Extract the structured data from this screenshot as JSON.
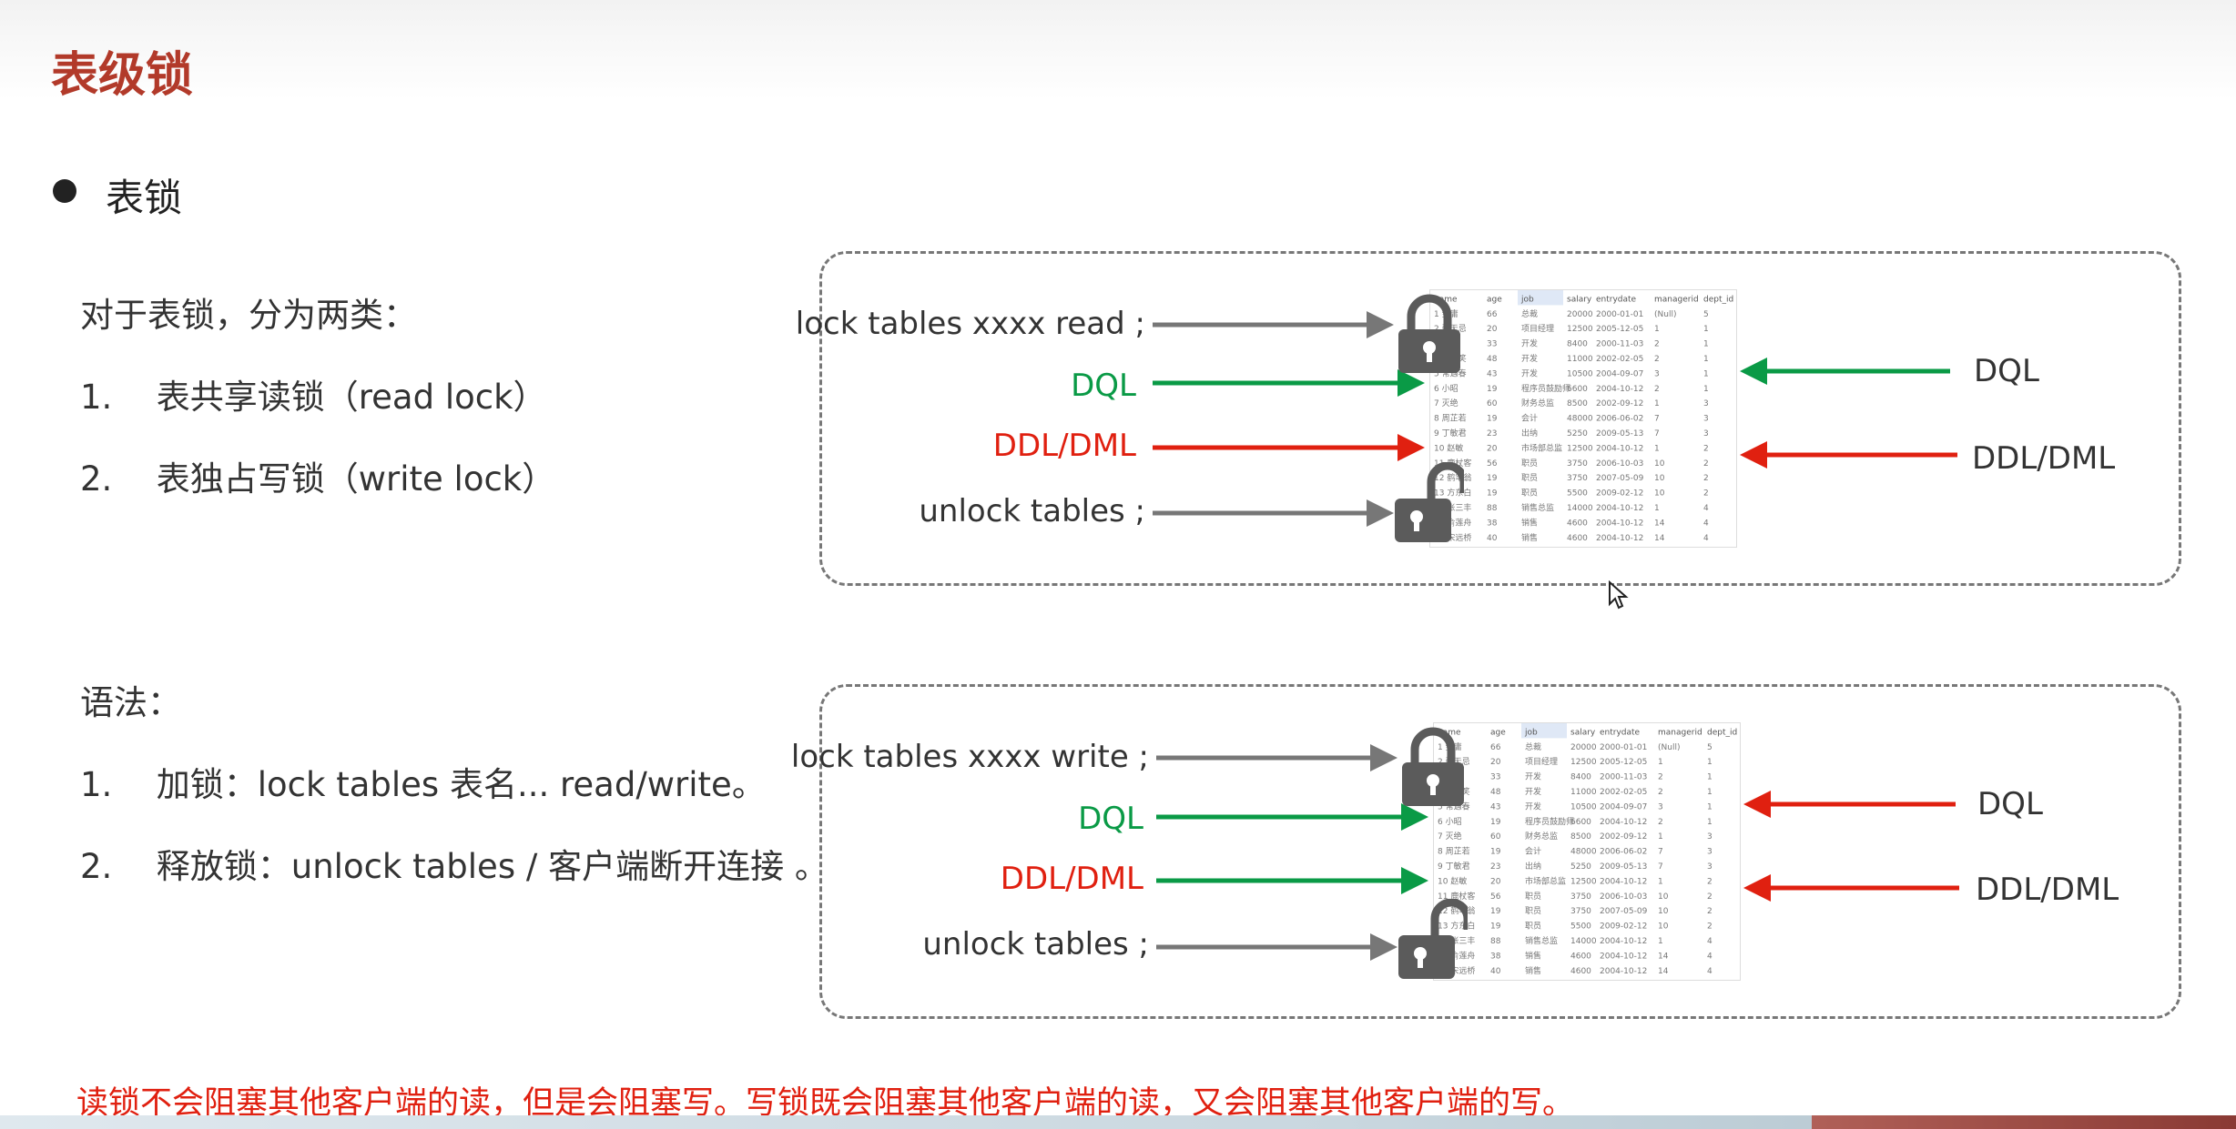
{
  "title": "表级锁",
  "bullet": "表锁",
  "intro": {
    "heading": "对于表锁，分为两类：",
    "items": [
      {
        "num": "1.",
        "text": "表共享读锁（read lock）"
      },
      {
        "num": "2.",
        "text": "表独占写锁（write lock）"
      }
    ]
  },
  "syntax": {
    "heading": "语法：",
    "items": [
      {
        "num": "1.",
        "text": "加锁：lock tables  表名...  read/write。"
      },
      {
        "num": "2.",
        "text": "释放锁：unlock  tables / 客户端断开连接 。"
      }
    ]
  },
  "read_diagram": {
    "left": [
      "lock tables xxxx read ;",
      "DQL",
      "DDL/DML",
      "unlock tables ;"
    ],
    "right": [
      "DQL",
      "DDL/DML"
    ]
  },
  "write_diagram": {
    "left": [
      "lock tables xxxx write ;",
      "DQL",
      "DDL/DML",
      "unlock tables ;"
    ],
    "right": [
      "DQL",
      "DDL/DML"
    ]
  },
  "table": {
    "header": [
      "name",
      "age",
      "job",
      "salary",
      "entrydate",
      "managerid",
      "dept_id"
    ],
    "rows": [
      [
        "金庸",
        "66",
        "总裁",
        "20000",
        "2000-01-01",
        "(Null)",
        "5"
      ],
      [
        "张无忌",
        "20",
        "项目经理",
        "12500",
        "2005-12-05",
        "1",
        "1"
      ],
      [
        "杨逍",
        "33",
        "开发",
        "8400",
        "2000-11-03",
        "2",
        "1"
      ],
      [
        "韦一笑",
        "48",
        "开发",
        "11000",
        "2002-02-05",
        "2",
        "1"
      ],
      [
        "常遇春",
        "43",
        "开发",
        "10500",
        "2004-09-07",
        "3",
        "1"
      ],
      [
        "小昭",
        "19",
        "程序员鼓励师",
        "6600",
        "2004-10-12",
        "2",
        "1"
      ],
      [
        "灭绝",
        "60",
        "财务总监",
        "8500",
        "2002-09-12",
        "1",
        "3"
      ],
      [
        "周芷若",
        "19",
        "会计",
        "48000",
        "2006-06-02",
        "7",
        "3"
      ],
      [
        "丁敏君",
        "23",
        "出纳",
        "5250",
        "2009-05-13",
        "7",
        "3"
      ],
      [
        "赵敏",
        "20",
        "市场部总监",
        "12500",
        "2004-10-12",
        "1",
        "2"
      ],
      [
        "鹿杖客",
        "56",
        "职员",
        "3750",
        "2006-10-03",
        "10",
        "2"
      ],
      [
        "鹤笔翁",
        "19",
        "职员",
        "3750",
        "2007-05-09",
        "10",
        "2"
      ],
      [
        "方东白",
        "19",
        "职员",
        "5500",
        "2009-02-12",
        "10",
        "2"
      ],
      [
        "张三丰",
        "88",
        "销售总监",
        "14000",
        "2004-10-12",
        "1",
        "4"
      ],
      [
        "俞莲舟",
        "38",
        "销售",
        "4600",
        "2004-10-12",
        "14",
        "4"
      ],
      [
        "宋远桥",
        "40",
        "销售",
        "4600",
        "2004-10-12",
        "14",
        "4"
      ]
    ]
  },
  "footer": "读锁不会阻塞其他客户端的读，但是会阻塞写。写锁既会阻塞其他客户端的读，又会阻塞其他客户端的写。",
  "colors": {
    "title": "#b23a2a",
    "green": "#0a9a46",
    "red": "#e02010",
    "gray_arrow": "#777777"
  },
  "icons": [
    "lock-closed-icon",
    "lock-open-icon",
    "cursor-icon"
  ]
}
